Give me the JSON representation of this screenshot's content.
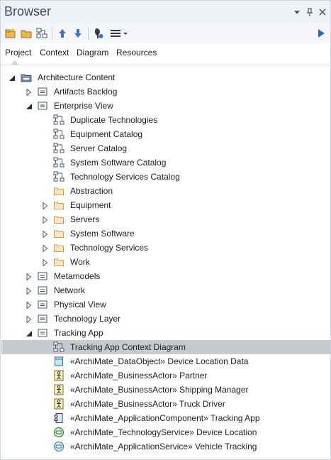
{
  "window": {
    "title": "Browser"
  },
  "colors": {
    "accent": "#2a6bc5",
    "selection": "#c6c9ce",
    "folder": "#e0a24a",
    "package": "#5a6f8f"
  },
  "toolbar": {
    "buttons": [
      "new-package-icon",
      "new-folder-icon",
      "new-diagram-icon",
      "move-up-icon",
      "move-down-icon",
      "locate-icon",
      "menu-icon",
      "run-icon"
    ]
  },
  "tabs": [
    {
      "label": "Project",
      "active": true
    },
    {
      "label": "Context"
    },
    {
      "label": "Diagram"
    },
    {
      "label": "Resources"
    }
  ],
  "tree": [
    {
      "label": "Architecture Content",
      "level": 0,
      "expander": "expanded",
      "icon": "root-package"
    },
    {
      "label": "Artifacts Backlog",
      "level": 1,
      "expander": "collapsed",
      "icon": "package"
    },
    {
      "label": "Enterprise View",
      "level": 1,
      "expander": "expanded",
      "icon": "package"
    },
    {
      "label": "Duplicate Technologies",
      "level": 2,
      "expander": "none",
      "icon": "diagram"
    },
    {
      "label": "Equipment Catalog",
      "level": 2,
      "expander": "none",
      "icon": "diagram"
    },
    {
      "label": "Server Catalog",
      "level": 2,
      "expander": "none",
      "icon": "diagram"
    },
    {
      "label": "System Software Catalog",
      "level": 2,
      "expander": "none",
      "icon": "diagram"
    },
    {
      "label": "Technology Services Catalog",
      "level": 2,
      "expander": "none",
      "icon": "diagram"
    },
    {
      "label": "Abstraction",
      "level": 2,
      "expander": "none",
      "icon": "folder"
    },
    {
      "label": "Equipment",
      "level": 2,
      "expander": "collapsed",
      "icon": "folder"
    },
    {
      "label": "Servers",
      "level": 2,
      "expander": "collapsed",
      "icon": "folder"
    },
    {
      "label": "System Software",
      "level": 2,
      "expander": "collapsed",
      "icon": "folder"
    },
    {
      "label": "Technology Services",
      "level": 2,
      "expander": "collapsed",
      "icon": "folder"
    },
    {
      "label": "Work",
      "level": 2,
      "expander": "collapsed",
      "icon": "folder"
    },
    {
      "label": "Metamodels",
      "level": 1,
      "expander": "collapsed",
      "icon": "package"
    },
    {
      "label": "Network",
      "level": 1,
      "expander": "collapsed",
      "icon": "package"
    },
    {
      "label": "Physical View",
      "level": 1,
      "expander": "collapsed",
      "icon": "package"
    },
    {
      "label": "Technology Layer",
      "level": 1,
      "expander": "collapsed",
      "icon": "package"
    },
    {
      "label": "Tracking App",
      "level": 1,
      "expander": "expanded",
      "icon": "package"
    },
    {
      "label": "Tracking App Context Diagram",
      "level": 2,
      "expander": "none",
      "icon": "diagram",
      "selected": true
    },
    {
      "label": "«ArchiMate_DataObject» Device Location Data",
      "level": 2,
      "expander": "none",
      "icon": "data-object"
    },
    {
      "label": "«ArchiMate_BusinessActor» Partner",
      "level": 2,
      "expander": "none",
      "icon": "business-actor"
    },
    {
      "label": "«ArchiMate_BusinessActor» Shipping Manager",
      "level": 2,
      "expander": "none",
      "icon": "business-actor"
    },
    {
      "label": "«ArchiMate_BusinessActor» Truck Driver",
      "level": 2,
      "expander": "none",
      "icon": "business-actor"
    },
    {
      "label": "«ArchiMate_ApplicationComponent» Tracking App",
      "level": 2,
      "expander": "none",
      "icon": "application-component"
    },
    {
      "label": "«ArchiMate_TechnologyService» Device Location",
      "level": 2,
      "expander": "none",
      "icon": "technology-service"
    },
    {
      "label": "«ArchiMate_ApplicationService» Vehicle Tracking",
      "level": 2,
      "expander": "none",
      "icon": "application-service"
    }
  ]
}
